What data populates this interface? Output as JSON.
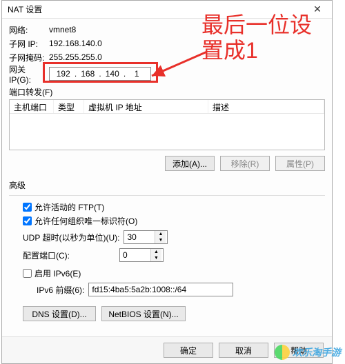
{
  "window": {
    "title": "NAT 设置",
    "close": "✕"
  },
  "net": {
    "network_label": "网络:",
    "network_value": "vmnet8",
    "subnet_ip_label": "子网 IP:",
    "subnet_ip_value": "192.168.140.0",
    "subnet_mask_label": "子网掩码:",
    "subnet_mask_value": "255.255.255.0",
    "gateway_label": "网关 IP(G):",
    "gateway": {
      "o1": "192",
      "o2": "168",
      "o3": "140",
      "o4": "1"
    }
  },
  "annotation": {
    "line1": "最后一位设",
    "line2": "置成1"
  },
  "port_forward": {
    "heading": "端口转发(F)",
    "cols": {
      "host_port": "主机端口",
      "type": "类型",
      "vm_ip": "虚拟机 IP 地址",
      "desc": "描述"
    },
    "add": "添加(A)...",
    "remove": "移除(R)",
    "props": "属性(P)"
  },
  "advanced": {
    "heading": "高级",
    "allow_active_ftp": "允许活动的 FTP(T)",
    "allow_any_oui": "允许任何组织唯一标识符(O)",
    "udp_timeout_label": "UDP 超时(以秒为单位)(U):",
    "udp_timeout_value": "30",
    "config_port_label": "配置端口(C):",
    "config_port_value": "0",
    "enable_ipv6_label": "启用 IPv6(E)",
    "ipv6_prefix_label": "IPv6 前缀(6):",
    "ipv6_prefix_value": "fd15:4ba5:5a2b:1008::/64",
    "dns_settings": "DNS 设置(D)...",
    "netbios_settings": "NetBIOS 设置(N)..."
  },
  "footer": {
    "ok": "确定",
    "cancel": "取消",
    "help": "帮助"
  },
  "watermark": "欢乐淘手游"
}
